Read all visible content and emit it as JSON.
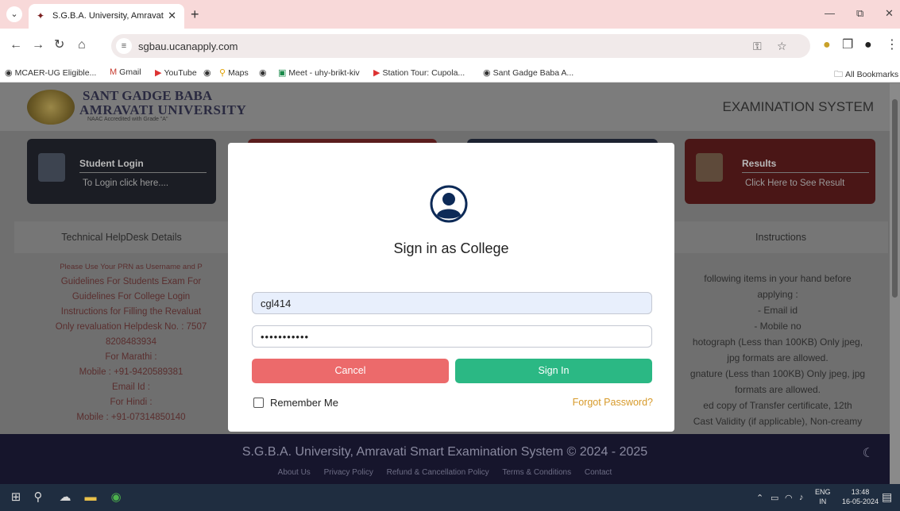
{
  "browser": {
    "tab_title": "S.G.B.A. University, Amravati",
    "new_tab": "+",
    "url": "sgbau.ucanapply.com",
    "window": {
      "minimize": "—",
      "maximize": "⧉",
      "close": "✕"
    }
  },
  "bookmarks": [
    "MCAER-UG Eligible...",
    "Gmail",
    "YouTube",
    "",
    "Maps",
    "",
    "Meet - uhy-brikt-kiv",
    "Station Tour: Cupola...",
    "Sant Gadge Baba A..."
  ],
  "all_bookmarks": "All Bookmarks",
  "header": {
    "univ_line1": "SANT GADGE BABA",
    "univ_line2": "AMRAVATI UNIVERSITY",
    "univ_sub": "NAAC Accredited with Grade \"A\"",
    "exam_system": "EXAMINATION SYSTEM"
  },
  "cards": {
    "student_title": "Student Login",
    "student_sub": "To Login click here....",
    "results_title": "Results",
    "results_sub": "Click Here to See Result"
  },
  "sections": {
    "helpdesk": "Technical HelpDesk Details",
    "instructions": "Instructions"
  },
  "helpdesk_lines": [
    "Please Use Your PRN as Username and P",
    "Guidelines For Students Exam For",
    "Guidelines For College Login",
    "Instructions for Filling the Revaluat",
    "Only revaluation Helpdesk No. : 7507",
    "8208483934",
    "For Marathi :",
    "Mobile : +91-9420589381",
    "Email Id :",
    "For Hindi :",
    "Mobile : +91-07314850140"
  ],
  "instruction_lines": [
    "following items in your hand before",
    "applying :",
    "- Email id",
    "- Mobile no",
    "hotograph (Less than 100KB) Only jpeg,",
    "jpg formats are allowed.",
    "gnature (Less than 100KB) Only jpeg, jpg",
    "formats are allowed.",
    "ed copy of Transfer certificate, 12th",
    "Cast Validity (if applicable), Non-creamy"
  ],
  "footer": {
    "title": "S.G.B.A. University, Amravati Smart Examination System © 2024 - 2025",
    "links": [
      "About Us",
      "Privacy Policy",
      "Refund & Cancellation Policy",
      "Terms & Conditions",
      "Contact"
    ]
  },
  "modal": {
    "title": "Sign in as College",
    "username_value": "cgl414",
    "password_value": "•••••••••••",
    "cancel_label": "Cancel",
    "signin_label": "Sign In",
    "remember_label": "Remember Me",
    "forgot_label": "Forgot Password?"
  },
  "taskbar": {
    "lang_top": "ENG",
    "lang_bottom": "IN",
    "time": "13:48",
    "date": "16-05-2024"
  },
  "colors": {
    "cancel": "#ec6a6b",
    "signin": "#2bb884",
    "forgot": "#d79a2a",
    "footer": "#16152c"
  }
}
